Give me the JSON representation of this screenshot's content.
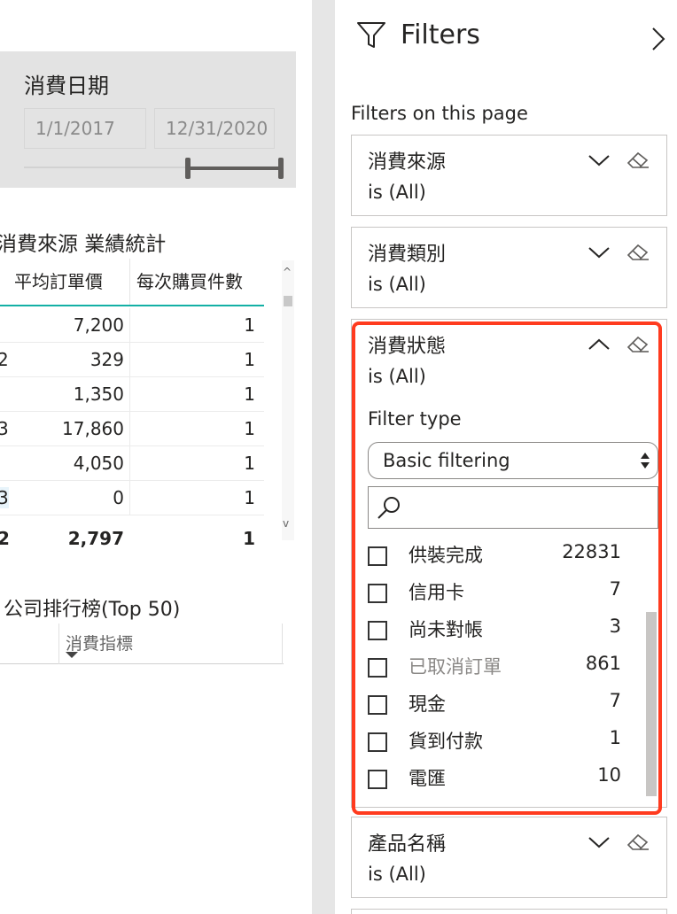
{
  "slicer": {
    "title": "消費日期",
    "start_date": "1/1/2017",
    "end_date": "12/31/2020"
  },
  "table": {
    "title": "消費來源 業績統計",
    "columns": [
      "平均訂單價",
      "每次購買件數"
    ],
    "rows": [
      {
        "cut": "",
        "avg_order": "7,200",
        "items": "1"
      },
      {
        "cut": "2",
        "avg_order": "329",
        "items": "1"
      },
      {
        "cut": "",
        "avg_order": "1,350",
        "items": "1"
      },
      {
        "cut": "3",
        "avg_order": "17,860",
        "items": "1"
      },
      {
        "cut": "",
        "avg_order": "4,050",
        "items": "1"
      },
      {
        "cut": "3",
        "avg_order": "0",
        "items": "1"
      }
    ],
    "total": {
      "cut": "2",
      "avg_order": "2,797",
      "items": "1"
    },
    "scroll_up": "^",
    "scroll_down": "v"
  },
  "ranking": {
    "title": "公司排行榜(Top 50)",
    "column": "消費指標"
  },
  "filters": {
    "title": "Filters",
    "section_label": "Filters on this page",
    "cards": [
      {
        "title": "消費來源",
        "state": "is (All)"
      },
      {
        "title": "消費類別",
        "state": "is (All)"
      },
      {
        "title": "消費狀態",
        "state": "is (All)"
      },
      {
        "title": "產品名稱",
        "state": "is (All)"
      }
    ],
    "expanded": {
      "filter_type_label": "Filter type",
      "filter_type_value": "Basic filtering",
      "options": [
        {
          "label": "供裝完成",
          "count": "22831"
        },
        {
          "label": "信用卡",
          "count": "7"
        },
        {
          "label": "尚未對帳",
          "count": "3"
        },
        {
          "label": "已取消訂單",
          "count": "861"
        },
        {
          "label": "現金",
          "count": "7"
        },
        {
          "label": "貨到付款",
          "count": "1"
        },
        {
          "label": "電匯",
          "count": "10"
        }
      ]
    },
    "highlight_color": "#ff3b1f"
  }
}
